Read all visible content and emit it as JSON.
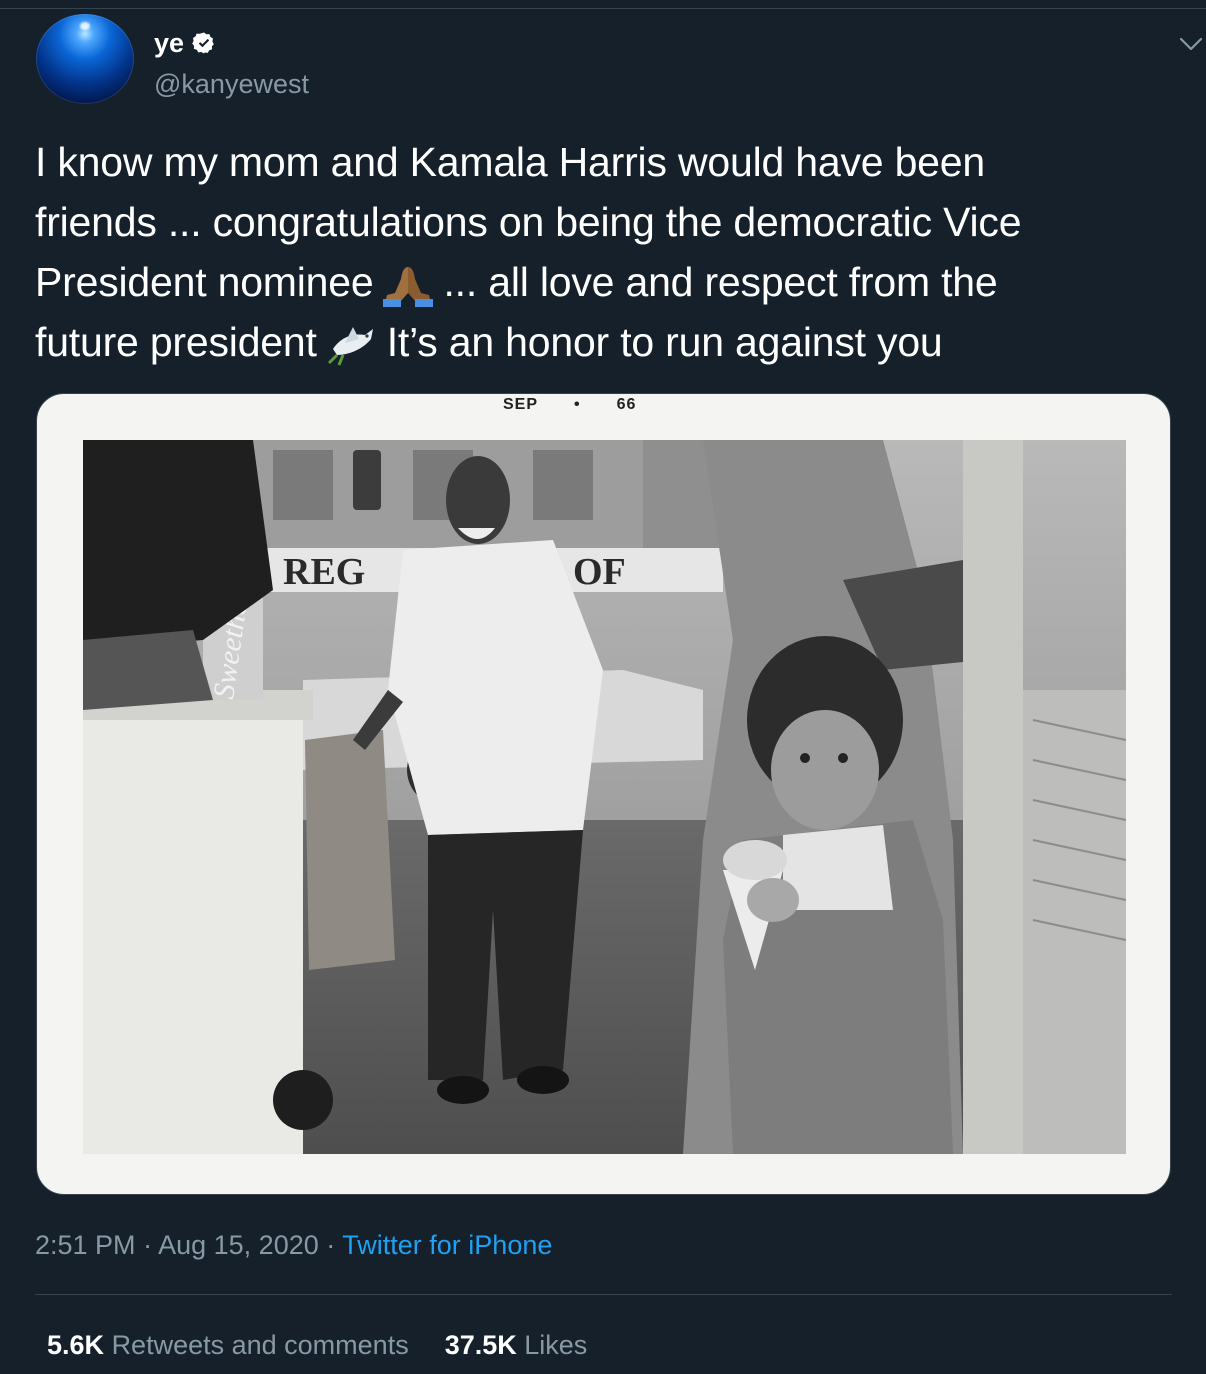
{
  "tweet": {
    "author": {
      "display_name": "ye",
      "handle": "@kanyewest",
      "verified_icon": "verified-badge-icon"
    },
    "text_lines": [
      "I know my mom and Kamala Harris would have been",
      "friends ... congratulations on being the democratic Vice",
      "President nominee",
      "... all love and respect from the",
      "future president",
      "It’s an honor to run against you"
    ],
    "emoji": [
      "folded-hands-icon",
      "dove-icon"
    ],
    "photo": {
      "stamp_month": "SEP",
      "stamp_year": "66",
      "sign_text_left": "REG",
      "sign_text_right": "OF",
      "cart_text": "Sweethe"
    },
    "meta": {
      "time": "2:51 PM",
      "separator": "·",
      "date": "Aug 15, 2020",
      "source": "Twitter for iPhone"
    },
    "stats": {
      "retweets_count": "5.6K",
      "retweets_label": "Retweets and comments",
      "likes_count": "37.5K",
      "likes_label": "Likes"
    }
  },
  "colors": {
    "background": "#15202b",
    "secondary_text": "#8899a6",
    "link": "#1da1f2",
    "divider": "#38444d"
  }
}
